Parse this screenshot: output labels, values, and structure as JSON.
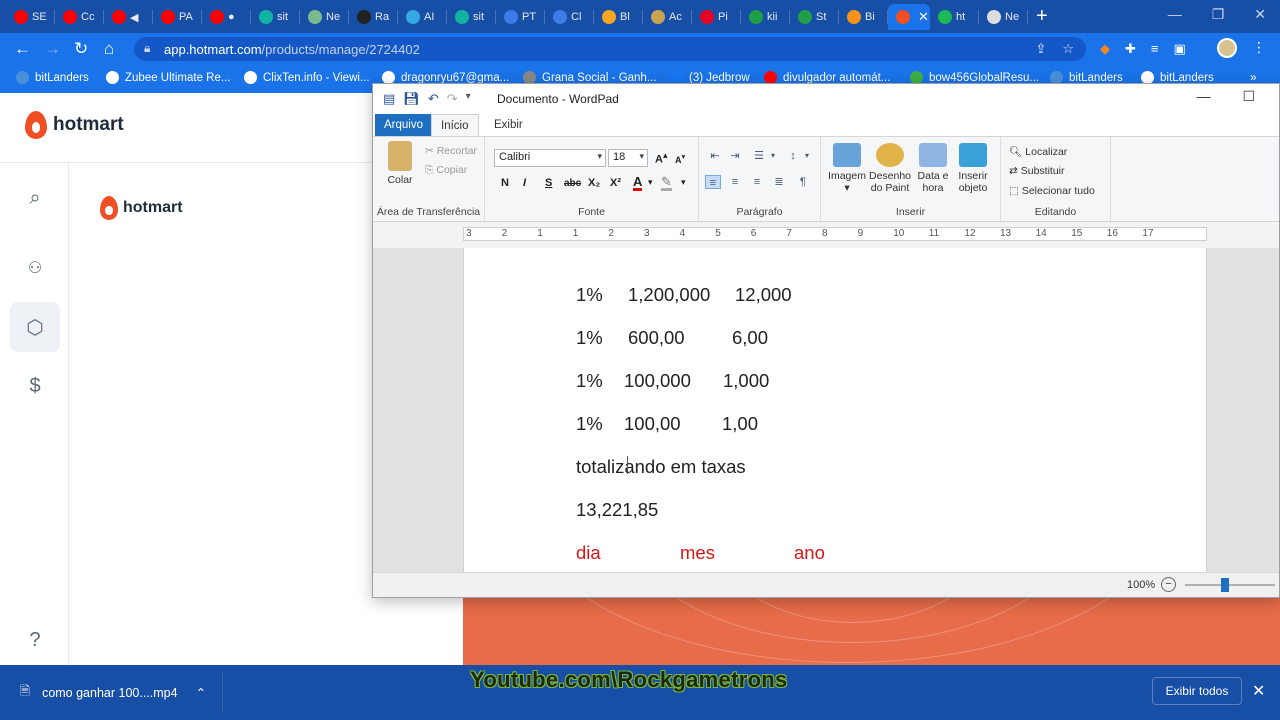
{
  "browser": {
    "tabs": [
      {
        "label": "SE",
        "color": "#ff0000"
      },
      {
        "label": "Cc",
        "color": "#ff0000"
      },
      {
        "label": "◀",
        "color": "#ff0000"
      },
      {
        "label": "PA",
        "color": "#ff0000"
      },
      {
        "label": "●",
        "color": "#ff0000"
      },
      {
        "label": "sit",
        "color": "#12b3a0"
      },
      {
        "label": "Ne",
        "color": "#7ab98d"
      },
      {
        "label": "Ra",
        "color": "#222222"
      },
      {
        "label": "AI",
        "color": "#34a8e0"
      },
      {
        "label": "sit",
        "color": "#12b3a0"
      },
      {
        "label": "PT",
        "color": "#3c7be8"
      },
      {
        "label": "Cl",
        "color": "#3c7be8"
      },
      {
        "label": "Bl",
        "color": "#f6a623"
      },
      {
        "label": "Ac",
        "color": "#c9a352"
      },
      {
        "label": "Pi",
        "color": "#e60023"
      },
      {
        "label": "kii",
        "color": "#1fa046"
      },
      {
        "label": "St",
        "color": "#1fa046"
      },
      {
        "label": "Bi",
        "color": "#f7931a"
      },
      {
        "label": "",
        "color": "#f04e23",
        "active": true
      },
      {
        "label": "ht",
        "color": "#1db954"
      },
      {
        "label": "Ne",
        "color": "#dddddd"
      }
    ],
    "url_host": "app.hotmart.com",
    "url_path": "/products/manage/2724402",
    "bookmarks": [
      {
        "label": "bitLanders",
        "color": "#4a90d9"
      },
      {
        "label": "Zubee Ultimate Re...",
        "color": "#ffffff"
      },
      {
        "label": "ClixTen.info - Viewi...",
        "color": "#ffffff"
      },
      {
        "label": "dragonryu67@gma...",
        "color": "#ffffff"
      },
      {
        "label": "Grana Social - Ganh...",
        "color": "#888888"
      },
      {
        "label": "(3) Jedbrow",
        "color": "#1877f2"
      },
      {
        "label": "divulgador automát...",
        "color": "#ff0000"
      },
      {
        "label": "bow456GlobalResu...",
        "color": "#3cb043"
      },
      {
        "label": "bitLanders",
        "color": "#4a90d9"
      },
      {
        "label": "bitLanders",
        "color": "#ffffff"
      }
    ]
  },
  "hotmart": {
    "brand": "hotmart",
    "brand_color": "#f04e23"
  },
  "wordpad": {
    "title": "Documento - WordPad",
    "tabs": {
      "file": "Arquivo",
      "home": "Início",
      "view": "Exibir"
    },
    "clipboard": {
      "paste": "Colar",
      "cut": "Recortar",
      "copy": "Copiar",
      "label": "Área de Transferência"
    },
    "font": {
      "family": "Calibri",
      "size": "18",
      "label": "Fonte",
      "bold": "N",
      "italic": "I",
      "underline": "S",
      "strike": "abc",
      "sub": "X₂",
      "sup": "X²"
    },
    "paragraph": {
      "label": "Parágrafo"
    },
    "insert": {
      "image": "Imagem",
      "paint": "Desenho do Paint",
      "datetime": "Data e hora",
      "object": "Inserir objeto",
      "label": "Inserir"
    },
    "editing": {
      "find": "Localizar",
      "replace": "Substituir",
      "select_all": "Selecionar tudo",
      "label": "Editando"
    },
    "ruler": [
      "3",
      "2",
      "1",
      "1",
      "2",
      "3",
      "4",
      "5",
      "6",
      "7",
      "8",
      "9",
      "10",
      "11",
      "12",
      "13",
      "14",
      "15",
      "16",
      "17"
    ],
    "document": {
      "rows": [
        [
          "1%",
          "1,200,000",
          "12,000"
        ],
        [
          "1%",
          "600,00",
          "6,00"
        ],
        [
          "1%",
          "100,000",
          "1,000"
        ],
        [
          "1%",
          "100,00",
          "1,00"
        ]
      ],
      "line_total": "totalizando em taxas",
      "line_value": "13,221,85",
      "line_red": [
        "dia",
        "mes",
        "ano"
      ]
    },
    "zoom": "100%"
  },
  "downloads": {
    "file": "como ganhar 100....mp4",
    "show_all": "Exibir todos",
    "watermark": "Youtube.com\\Rockgametrons"
  }
}
